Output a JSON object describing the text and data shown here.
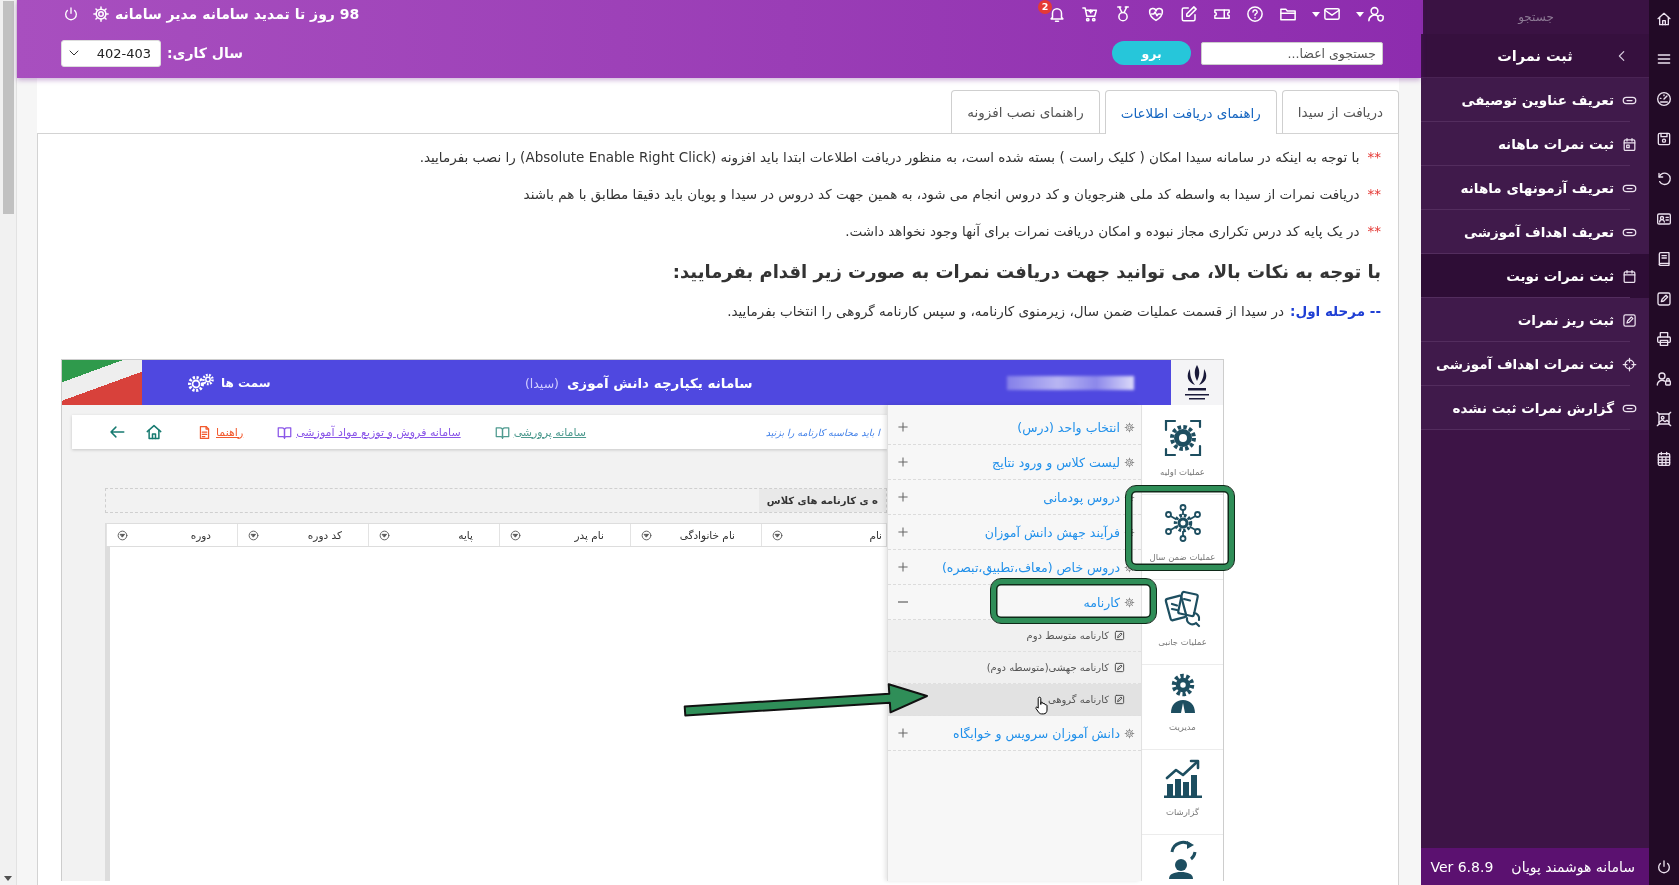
{
  "header": {
    "expiry_notice": "98 روز تا تمدید سامانه مدیر سامانه",
    "notification_badge": "2",
    "year": {
      "label": "سال کاری:",
      "value": "402-403"
    },
    "member_search": {
      "placeholder": "جستجوی اعضا..."
    },
    "go_button": "برو"
  },
  "tabs": [
    {
      "label": "دریافت از سیدا",
      "selected": false
    },
    {
      "label": "راهنمای دریافت اطلاعات",
      "selected": true
    },
    {
      "label": "راهنمای نصب افزونه",
      "selected": false
    }
  ],
  "notes": [
    {
      "marker": "**",
      "text": "با توجه به اینکه در سامانه سیدا امکان ( کلیک راست ) بسته شده است، به منظور دریافت اطلاعات ابتدا باید افزونه (Absolute Enable Right Click) را نصب بفرمایید."
    },
    {
      "marker": "**",
      "text": "دریافت نمرات از سیدا به واسطه کد ملی هنرجویان و کد دروس انجام می شود، به همین جهت کد دروس در سیدا و پویان باید دقیقا مطابق با هم باشند"
    },
    {
      "marker": "**",
      "text": "در یک پایه کد درس تکراری مجاز نبوده و امکان دریافت نمرات برای آنها وجود نخواهد داشت."
    }
  ],
  "heading": "با توجه به نکات بالا، می توانید جهت دریافت نمرات به صورت زیر اقدام بفرمایید:",
  "step": {
    "label": "-- مرحله اول:",
    "text": "در سیدا از قسمت عملیات ضمن سال، زیرمنوی کارنامه، و سپس کارنامه گروهی را انتخاب بفرمایید."
  },
  "embedded_screenshot": {
    "header": {
      "roles": "سمت ها",
      "title": "سامانه یکپارچه دانش آموزی",
      "title_suffix": "(سیدا)"
    },
    "toolbar": {
      "hint": "ا باید محاسبه کارنامه را بزنید",
      "links": [
        {
          "label": "سامانه پرورشی",
          "color": "#4e9a8f"
        },
        {
          "label": "سامانه فروش و توزیع مواد آموزشی",
          "color": "#8a56e8"
        },
        {
          "label": "راهنما",
          "color": "#f25a2e"
        }
      ]
    },
    "section_tab": "ه ی کارنامه های کلاس",
    "table": {
      "columns": [
        "نام",
        "نام خانوادگی",
        "نام پدر",
        "پایه",
        "کد دوره",
        "دوره"
      ]
    },
    "menu": {
      "items": [
        {
          "label": "انتخاب واحد (درس)",
          "expanded": false,
          "highlighted": false
        },
        {
          "label": "لیست کلاس و ورود نتایج",
          "expanded": false,
          "highlighted": false
        },
        {
          "label": "دروس پودمانی",
          "expanded": false,
          "highlighted": false
        },
        {
          "label": "فرآیند جهش دانش آموزان",
          "expanded": false,
          "highlighted": false
        },
        {
          "label": "دروس خاص (معاف،تطبیق،تبصره)",
          "expanded": false,
          "highlighted": false
        },
        {
          "label": "کارنامه",
          "expanded": true,
          "highlighted": true,
          "children": [
            {
              "label": "کارنامه متوسط دوم",
              "hovered": false
            },
            {
              "label": "کارنامه جهشی(متوسطه دوم)",
              "hovered": false
            },
            {
              "label": "کارنامه گروهی",
              "hovered": true
            }
          ]
        },
        {
          "label": "دانش آموزان سرویس و خوابگاه",
          "expanded": false,
          "highlighted": false
        }
      ]
    },
    "modules": [
      {
        "label": "عملیات اولیه",
        "highlighted": false
      },
      {
        "label": "عملیات ضمن سال",
        "highlighted": true
      },
      {
        "label": "عملیات جانبی",
        "highlighted": false
      },
      {
        "label": "مدیریت",
        "highlighted": false
      },
      {
        "label": "گزارشات",
        "highlighted": false
      }
    ]
  },
  "sidebar": {
    "search": {
      "placeholder": "جستجو"
    },
    "title": "ثبت نمرات",
    "items": [
      {
        "label": "تعریف عناوین توصیفی",
        "selected": false
      },
      {
        "label": "ثبت نمرات ماهانه",
        "selected": false
      },
      {
        "label": "تعریف آزمونهای ماهانه",
        "selected": false
      },
      {
        "label": "تعریف اهداف آموزشی",
        "selected": false
      },
      {
        "label": "ثبت نمرات نوبت",
        "selected": true
      },
      {
        "label": "ثبت ریز نمرات",
        "selected": false
      },
      {
        "label": "ثبت نمرات اهداف آموزشی",
        "selected": false
      },
      {
        "label": "گزارش نمرات ثبت نشده",
        "selected": false
      }
    ],
    "footer": {
      "product": "سامانه هوشمند پویان",
      "version": "Ver 6.8.9"
    }
  }
}
